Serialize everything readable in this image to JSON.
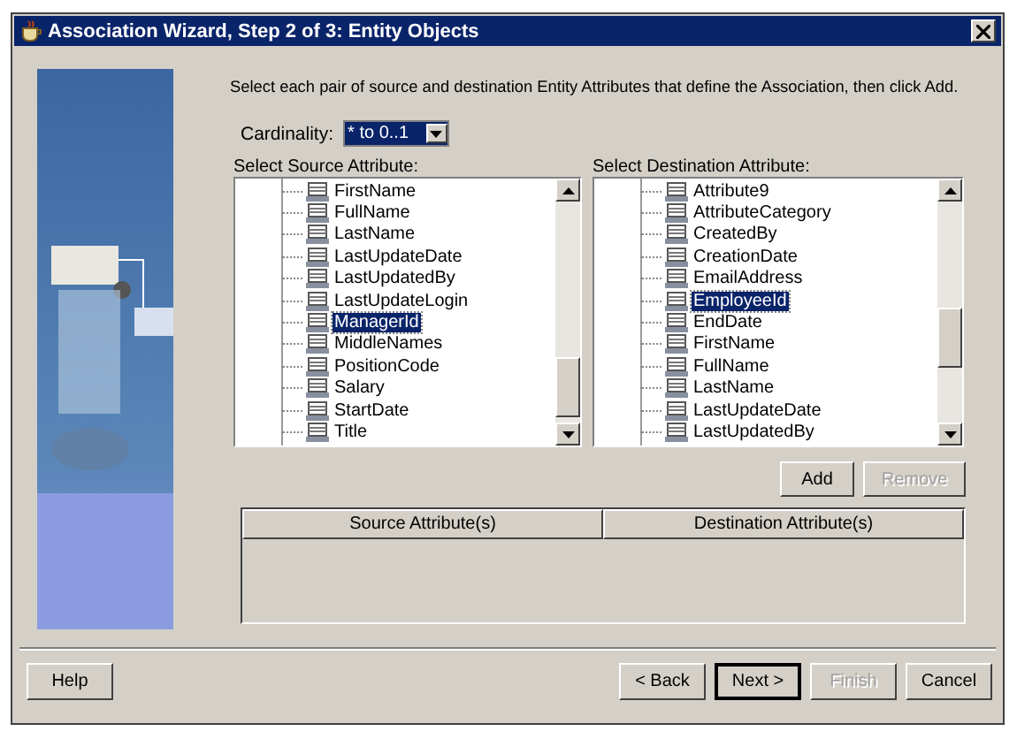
{
  "window": {
    "title": "Association Wizard, Step 2 of 3: Entity Objects"
  },
  "instruction": "Select each pair of source and destination Entity Attributes that define the Association, then click Add.",
  "cardinality": {
    "label": "Cardinality:",
    "value": "* to 0..1"
  },
  "source": {
    "label": "Select Source Attribute:",
    "items": [
      {
        "label": "FirstName",
        "selected": false
      },
      {
        "label": "FullName",
        "selected": false
      },
      {
        "label": "LastName",
        "selected": false
      },
      {
        "label": "LastUpdateDate",
        "selected": false
      },
      {
        "label": "LastUpdatedBy",
        "selected": false
      },
      {
        "label": "LastUpdateLogin",
        "selected": false
      },
      {
        "label": "ManagerId",
        "selected": true
      },
      {
        "label": "MiddleNames",
        "selected": false
      },
      {
        "label": "PositionCode",
        "selected": false
      },
      {
        "label": "Salary",
        "selected": false
      },
      {
        "label": "StartDate",
        "selected": false
      },
      {
        "label": "Title",
        "selected": false
      }
    ]
  },
  "destination": {
    "label": "Select Destination Attribute:",
    "items": [
      {
        "label": "Attribute9",
        "selected": false
      },
      {
        "label": "AttributeCategory",
        "selected": false
      },
      {
        "label": "CreatedBy",
        "selected": false
      },
      {
        "label": "CreationDate",
        "selected": false
      },
      {
        "label": "EmailAddress",
        "selected": false
      },
      {
        "label": "EmployeeId",
        "selected": true
      },
      {
        "label": "EndDate",
        "selected": false
      },
      {
        "label": "FirstName",
        "selected": false
      },
      {
        "label": "FullName",
        "selected": false
      },
      {
        "label": "LastName",
        "selected": false
      },
      {
        "label": "LastUpdateDate",
        "selected": false
      },
      {
        "label": "LastUpdatedBy",
        "selected": false
      }
    ]
  },
  "pair_buttons": [
    {
      "label": "Add",
      "disabled": false
    },
    {
      "label": "Remove",
      "disabled": true
    }
  ],
  "table": {
    "columns": [
      "Source Attribute(s)",
      "Destination Attribute(s)"
    ]
  },
  "footer": {
    "help": "Help",
    "buttons": [
      {
        "label": "< Back",
        "disabled": false,
        "default": false
      },
      {
        "label": "Next >",
        "disabled": false,
        "default": true
      },
      {
        "label": "Finish",
        "disabled": true,
        "default": false
      },
      {
        "label": "Cancel",
        "disabled": false,
        "default": false
      }
    ]
  }
}
